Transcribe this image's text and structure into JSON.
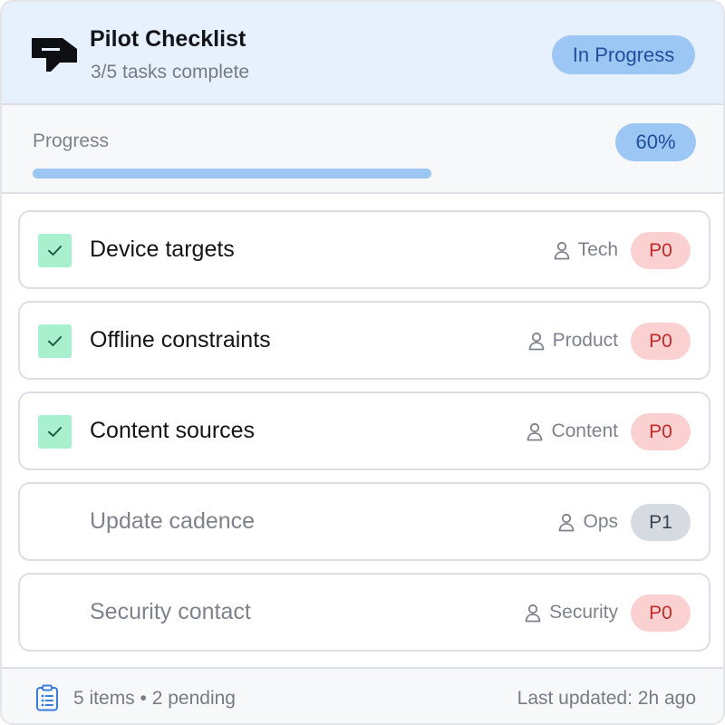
{
  "header": {
    "title": "Pilot Checklist",
    "subtitle": "3/5 tasks complete",
    "status": "In Progress",
    "logo_icon": "brand-logo-icon"
  },
  "progress": {
    "label": "Progress",
    "percent_label": "60%",
    "value": 60
  },
  "tasks": [
    {
      "title": "Device targets",
      "owner": "Tech",
      "priority": "P0",
      "done": true
    },
    {
      "title": "Offline constraints",
      "owner": "Product",
      "priority": "P0",
      "done": true
    },
    {
      "title": "Content sources",
      "owner": "Content",
      "priority": "P0",
      "done": true
    },
    {
      "title": "Update cadence",
      "owner": "Ops",
      "priority": "P1",
      "done": false
    },
    {
      "title": "Security contact",
      "owner": "Security",
      "priority": "P0",
      "done": false
    }
  ],
  "footer": {
    "summary": "5 items • 2 pending",
    "updated": "Last updated: 2h ago",
    "icon": "clipboard-list-icon"
  },
  "colors": {
    "accent": "#9cc6f4",
    "accent_text": "#1f4f9b",
    "header_bg": "#e7f0fd",
    "check_bg": "#a9f0cf",
    "p0_bg": "#fbd0d0",
    "p0_text": "#c32a2a",
    "p1_bg": "#d6dbe2"
  }
}
